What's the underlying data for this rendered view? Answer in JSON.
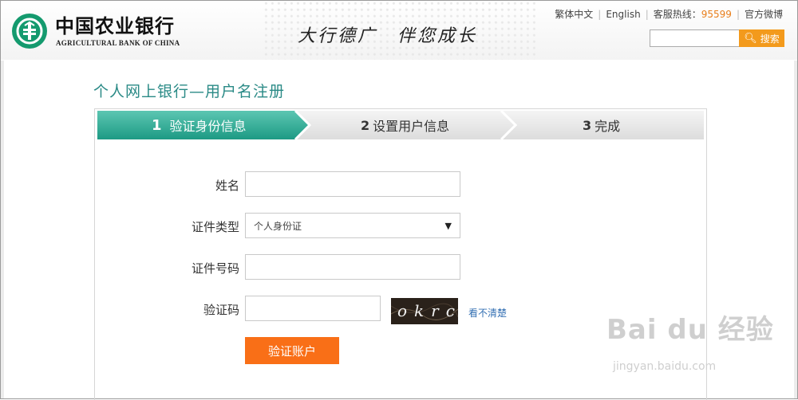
{
  "header": {
    "logo_cn": "中国农业银行",
    "logo_en": "AGRICULTURAL BANK OF CHINA",
    "slogan": "大行德广　伴您成长",
    "links": {
      "traditional": "繁体中文",
      "english": "English",
      "hotline_label": "客服热线：",
      "hotline_number": "95599",
      "weibo": "官方微博"
    },
    "search": {
      "placeholder": "",
      "button_label": "搜索"
    }
  },
  "page_title": "个人网上银行—用户名注册",
  "steps": [
    {
      "num": "1",
      "label": "验证身份信息",
      "active": true
    },
    {
      "num": "2",
      "label": "设置用户信息",
      "active": false
    },
    {
      "num": "3",
      "label": "完成",
      "active": false
    }
  ],
  "form": {
    "name_label": "姓名",
    "name_value": "",
    "id_type_label": "证件类型",
    "id_type_value": "个人身份证",
    "id_number_label": "证件号码",
    "id_number_value": "",
    "captcha_label": "验证码",
    "captcha_value": "",
    "captcha_image_text": "okrc",
    "captcha_refresh": "看不清楚",
    "submit_label": "验证账户"
  },
  "watermark": {
    "brand": "Bai du 经验",
    "url": "jingyan.baidu.com"
  },
  "colors": {
    "brand_green": "#149a6e",
    "step_active": "#22a38c",
    "title_teal": "#2a8a86",
    "accent_orange": "#f96f17",
    "hotline_orange": "#e87e1a"
  }
}
